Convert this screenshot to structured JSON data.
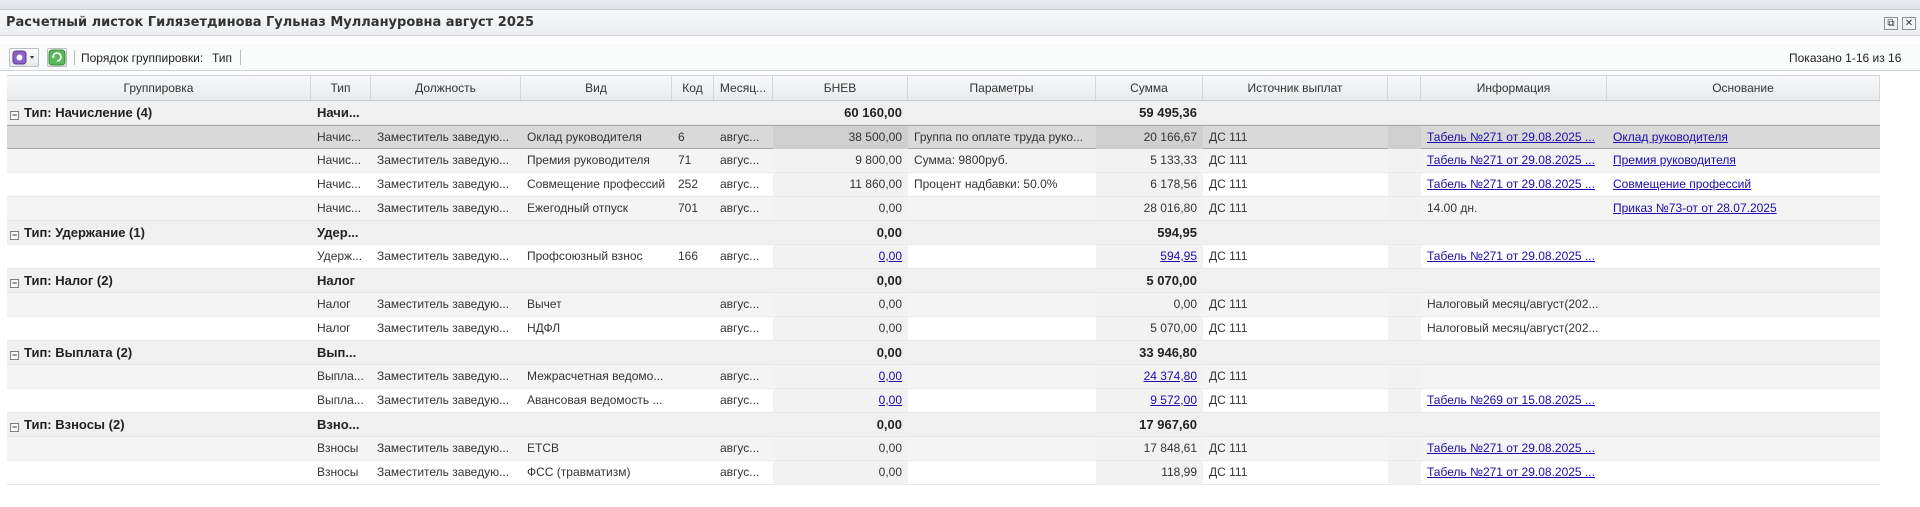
{
  "window": {
    "title": "Расчетный листок Гилязетдинова Гульназ Муллануровна август 2025",
    "restore_icon": "restore-window-icon",
    "close_icon": "close-icon"
  },
  "toolbar": {
    "group_label": "Порядок группировки:",
    "group_value": "Тип",
    "shown_text": "Показано 1-16 из 16"
  },
  "columns": [
    "Группировка",
    "Тип",
    "Должность",
    "Вид",
    "Код",
    "Месяц...",
    "БНЕВ",
    "Параметры",
    "Сумма",
    "Источник выплат",
    "",
    "Информация",
    "Основание"
  ],
  "groups": [
    {
      "label": "Тип: Начисление (4)",
      "type": "Начи...",
      "bnev": "60 160,00",
      "sum": "59 495,36",
      "rows": [
        {
          "type": "Начис...",
          "position": "Заместитель заведую...",
          "kind": "Оклад руководителя",
          "code": "6",
          "month": "авгус...",
          "bnev": "38 500,00",
          "bnev_link": false,
          "params": "Группа по оплате труда руко...",
          "sum": "20 166,67",
          "sum_link": false,
          "source": "ДС 111",
          "info": "Табель №271 от 29.08.2025 ...",
          "info_link": true,
          "basis": "Оклад руководителя",
          "basis_link": true,
          "selected": true
        },
        {
          "type": "Начис...",
          "position": "Заместитель заведую...",
          "kind": "Премия руководителя",
          "code": "71",
          "month": "авгус...",
          "bnev": "9 800,00",
          "bnev_link": false,
          "params": "Сумма: 9800руб.",
          "sum": "5 133,33",
          "sum_link": false,
          "source": "ДС 111",
          "info": "Табель №271 от 29.08.2025 ...",
          "info_link": true,
          "basis": "Премия руководителя",
          "basis_link": true
        },
        {
          "type": "Начис...",
          "position": "Заместитель заведую...",
          "kind": "Совмещение профессий",
          "code": "252",
          "month": "авгус...",
          "bnev": "11 860,00",
          "bnev_link": false,
          "params": "Процент надбавки: 50.0%",
          "sum": "6 178,56",
          "sum_link": false,
          "source": "ДС 111",
          "info": "Табель №271 от 29.08.2025 ...",
          "info_link": true,
          "basis": "Совмещение профессий",
          "basis_link": true
        },
        {
          "type": "Начис...",
          "position": "Заместитель заведую...",
          "kind": "Ежегодный отпуск",
          "code": "701",
          "month": "авгус...",
          "bnev": "0,00",
          "bnev_link": false,
          "params": "",
          "sum": "28 016,80",
          "sum_link": false,
          "source": "ДС 111",
          "info": "14.00 дн.",
          "info_link": false,
          "basis": "Приказ №73-от от 28.07.2025",
          "basis_link": true
        }
      ]
    },
    {
      "label": "Тип: Удержание (1)",
      "type": "Удер...",
      "bnev": "0,00",
      "sum": "594,95",
      "rows": [
        {
          "type": "Удерж...",
          "position": "Заместитель заведую...",
          "kind": "Профсоюзный взнос",
          "code": "166",
          "month": "авгус...",
          "bnev": "0,00",
          "bnev_link": true,
          "params": "",
          "sum": "594,95",
          "sum_link": true,
          "source": "ДС 111",
          "info": "Табель №271 от 29.08.2025 ...",
          "info_link": true,
          "basis": "",
          "basis_link": false
        }
      ]
    },
    {
      "label": "Тип: Налог (2)",
      "type": "Налог",
      "bnev": "0,00",
      "sum": "5 070,00",
      "rows": [
        {
          "type": "Налог",
          "position": "Заместитель заведую...",
          "kind": "Вычет",
          "code": "",
          "month": "авгус...",
          "bnev": "0,00",
          "bnev_link": false,
          "params": "",
          "sum": "0,00",
          "sum_link": false,
          "source": "ДС 111",
          "info": "Налоговый месяц/август(202...",
          "info_link": false,
          "basis": "",
          "basis_link": false
        },
        {
          "type": "Налог",
          "position": "Заместитель заведую...",
          "kind": "НДФЛ",
          "code": "",
          "month": "авгус...",
          "bnev": "0,00",
          "bnev_link": false,
          "params": "",
          "sum": "5 070,00",
          "sum_link": false,
          "source": "ДС 111",
          "info": "Налоговый месяц/август(202...",
          "info_link": false,
          "basis": "",
          "basis_link": false
        }
      ]
    },
    {
      "label": "Тип: Выплата (2)",
      "type": "Вып...",
      "bnev": "0,00",
      "sum": "33 946,80",
      "rows": [
        {
          "type": "Выпла...",
          "position": "Заместитель заведую...",
          "kind": "Межрасчетная ведомо...",
          "code": "",
          "month": "авгус...",
          "bnev": "0,00",
          "bnev_link": true,
          "params": "",
          "sum": "24 374,80",
          "sum_link": true,
          "source": "ДС 111",
          "info": "",
          "info_link": false,
          "basis": "",
          "basis_link": false
        },
        {
          "type": "Выпла...",
          "position": "Заместитель заведую...",
          "kind": "Авансовая ведомость ...",
          "code": "",
          "month": "авгус...",
          "bnev": "0,00",
          "bnev_link": true,
          "params": "",
          "sum": "9 572,00",
          "sum_link": true,
          "source": "ДС 111",
          "info": "Табель №269 от 15.08.2025 ...",
          "info_link": true,
          "basis": "",
          "basis_link": false
        }
      ]
    },
    {
      "label": "Тип: Взносы (2)",
      "type": "Взно...",
      "bnev": "0,00",
      "sum": "17 967,60",
      "rows": [
        {
          "type": "Взносы",
          "position": "Заместитель заведую...",
          "kind": "ЕТСВ",
          "code": "",
          "month": "авгус...",
          "bnev": "0,00",
          "bnev_link": false,
          "params": "",
          "sum": "17 848,61",
          "sum_link": false,
          "source": "ДС 111",
          "info": "Табель №271 от 29.08.2025 ...",
          "info_link": true,
          "basis": "",
          "basis_link": false
        },
        {
          "type": "Взносы",
          "position": "Заместитель заведую...",
          "kind": "ФСС (травматизм)",
          "code": "",
          "month": "авгус...",
          "bnev": "0,00",
          "bnev_link": false,
          "params": "",
          "sum": "118,99",
          "sum_link": false,
          "source": "ДС 111",
          "info": "Табель №271 от 29.08.2025 ...",
          "info_link": true,
          "basis": "",
          "basis_link": false
        }
      ]
    }
  ]
}
